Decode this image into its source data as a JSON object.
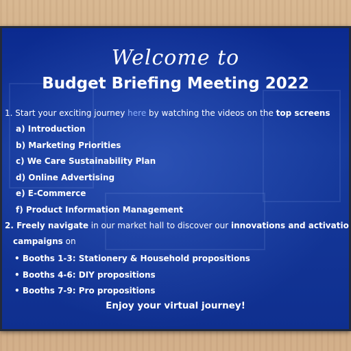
{
  "header": {
    "welcome": "Welcome to",
    "title": "Budget Briefing Meeting 2022"
  },
  "step1": {
    "prefix": "1. Start your exciting journey ",
    "link": "here",
    "middle": " by watching the videos on the ",
    "emphasis": "top screens",
    "items": [
      "a) Introduction",
      "b) Marketing Priorities",
      "c) We Care Sustainability Plan",
      "d) Online Advertising",
      "e) E-Commerce",
      "f) Product Information Management"
    ]
  },
  "step2": {
    "prefix": "2. Freely navigate",
    "middle": " in our market hall to discover our ",
    "emphasis": "innovations and activation",
    "line2": "campaigns",
    "line2_rest": " on",
    "bullets": [
      "• Booths 1-3: Stationery & Household propositions",
      "• Booths 4-6: DIY propositions",
      "• Booths 7-9: Pro propositions"
    ]
  },
  "closing": "Enjoy your virtual journey!",
  "colors": {
    "screen_blue": "#0f2f8f",
    "link_blue": "#8fb3ff",
    "text": "#ffffff"
  }
}
